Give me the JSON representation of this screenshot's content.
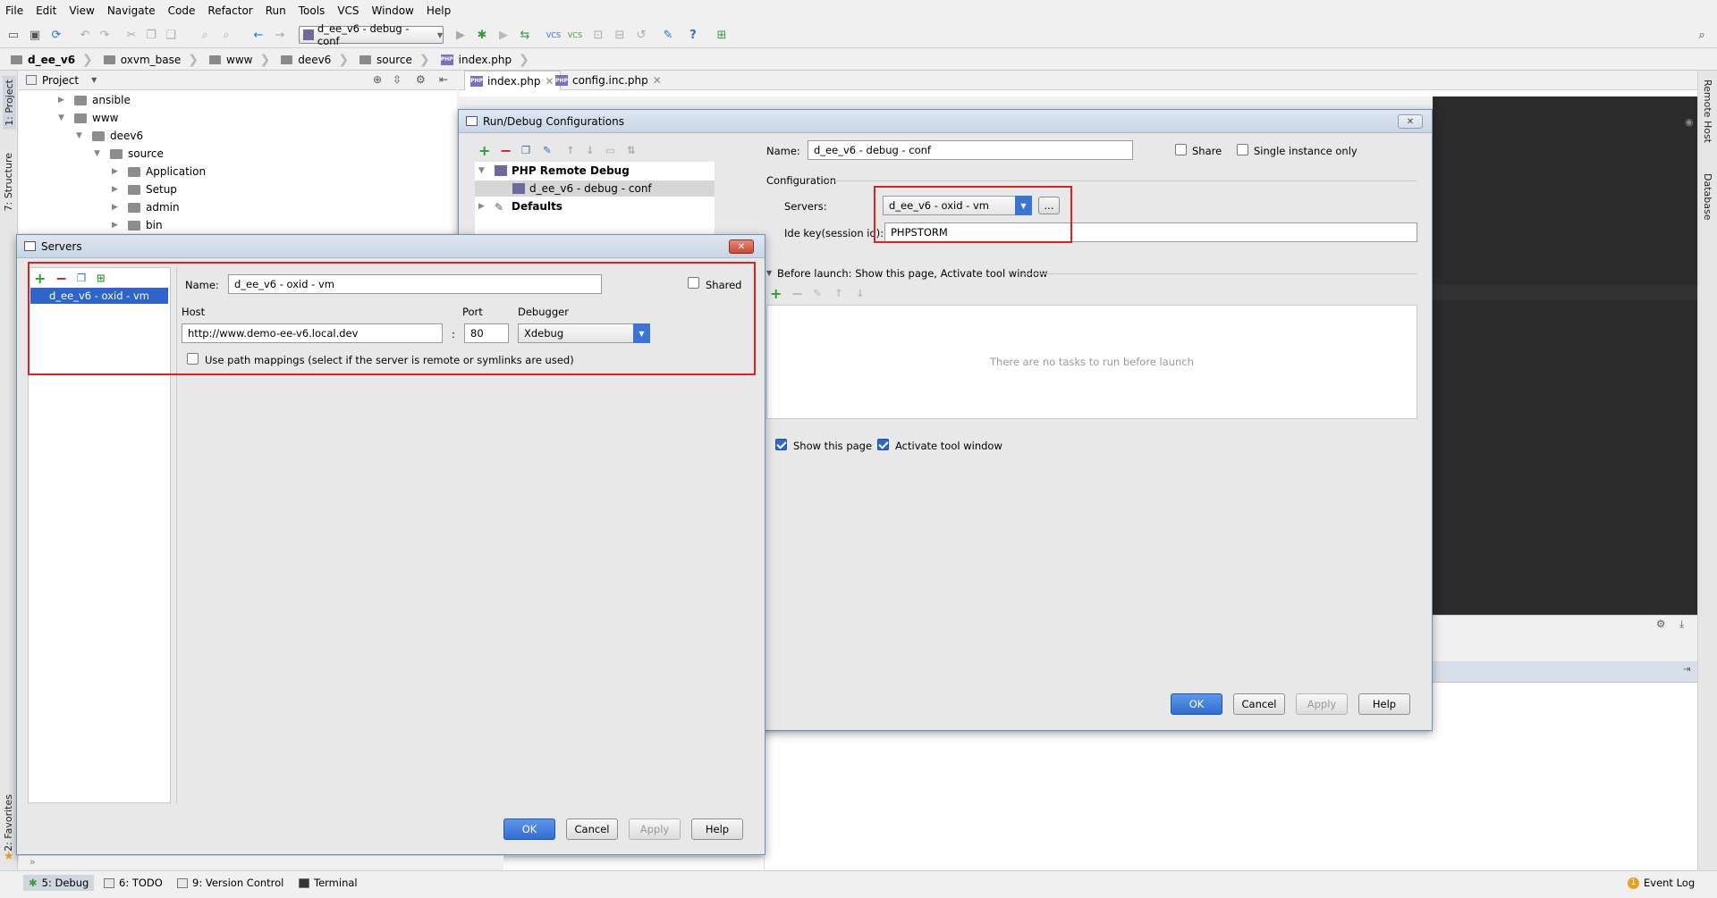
{
  "menu": [
    "File",
    "Edit",
    "View",
    "Navigate",
    "Code",
    "Refactor",
    "Run",
    "Tools",
    "VCS",
    "Window",
    "Help"
  ],
  "toolbar": {
    "run_config": "d_ee_v6 - debug - conf",
    "vcs1": "VCS",
    "vcs2": "VCS"
  },
  "breadcrumb": [
    "d_ee_v6",
    "oxvm_base",
    "www",
    "deev6",
    "source",
    "index.php"
  ],
  "left_tools": {
    "project": "1: Project",
    "structure": "7: Structure",
    "favorites": "2: Favorites"
  },
  "right_tools": {
    "remote_host": "Remote Host",
    "database": "Database"
  },
  "project_panel": {
    "title": "Project",
    "tree": [
      {
        "label": "ansible"
      },
      {
        "label": "www"
      },
      {
        "label": "deev6"
      },
      {
        "label": "source"
      },
      {
        "label": "Application"
      },
      {
        "label": "Setup"
      },
      {
        "label": "admin"
      },
      {
        "label": "bin"
      }
    ]
  },
  "editor_tabs": [
    {
      "label": "index.php",
      "active": true
    },
    {
      "label": "config.inc.php",
      "active": false
    }
  ],
  "run_debug": {
    "title": "Run/Debug Configurations",
    "tree_group": "PHP Remote Debug",
    "tree_item": "d_ee_v6 - debug - conf",
    "tree_defaults": "Defaults",
    "name_label": "Name:",
    "name_value": "d_ee_v6 - debug - conf",
    "share_label": "Share",
    "single_instance_label": "Single instance only",
    "section_configuration": "Configuration",
    "servers_label": "Servers:",
    "servers_value": "d_ee_v6 - oxid - vm",
    "servers_more": "...",
    "ide_key_label": "Ide key(session id):",
    "ide_key_value": "PHPSTORM",
    "before_launch": "Before launch: Show this page, Activate tool window",
    "no_tasks": "There are no tasks to run before launch",
    "show_page_label": "Show this page",
    "activate_tool_label": "Activate tool window",
    "show_page_checked": true,
    "activate_tool_checked": true,
    "ok": "OK",
    "cancel": "Cancel",
    "apply": "Apply",
    "help": "Help"
  },
  "servers_dialog": {
    "title": "Servers",
    "list_item": "d_ee_v6 - oxid - vm",
    "name_label": "Name:",
    "name_value": "d_ee_v6 - oxid - vm",
    "shared_label": "Shared",
    "host_label": "Host",
    "host_value": "http://www.demo-ee-v6.local.dev",
    "port_label": "Port",
    "port_value": "80",
    "port_sep": ":",
    "debugger_label": "Debugger",
    "debugger_value": "Xdebug",
    "path_mappings_label": "Use path mappings (select if the server is remote or symlinks are used)",
    "ok": "OK",
    "cancel": "Cancel",
    "apply": "Apply",
    "help": "Help"
  },
  "status_bar": {
    "debug": "5: Debug",
    "todo": "6: TODO",
    "version_control": "9: Version Control",
    "terminal": "Terminal",
    "event_log": "Event Log",
    "event_count": "1"
  },
  "colors": {
    "accent": "#2f6fd3",
    "highlight_box": "#e02020",
    "selection": "#2f65ca",
    "editor_bg": "#2b2b2b"
  }
}
